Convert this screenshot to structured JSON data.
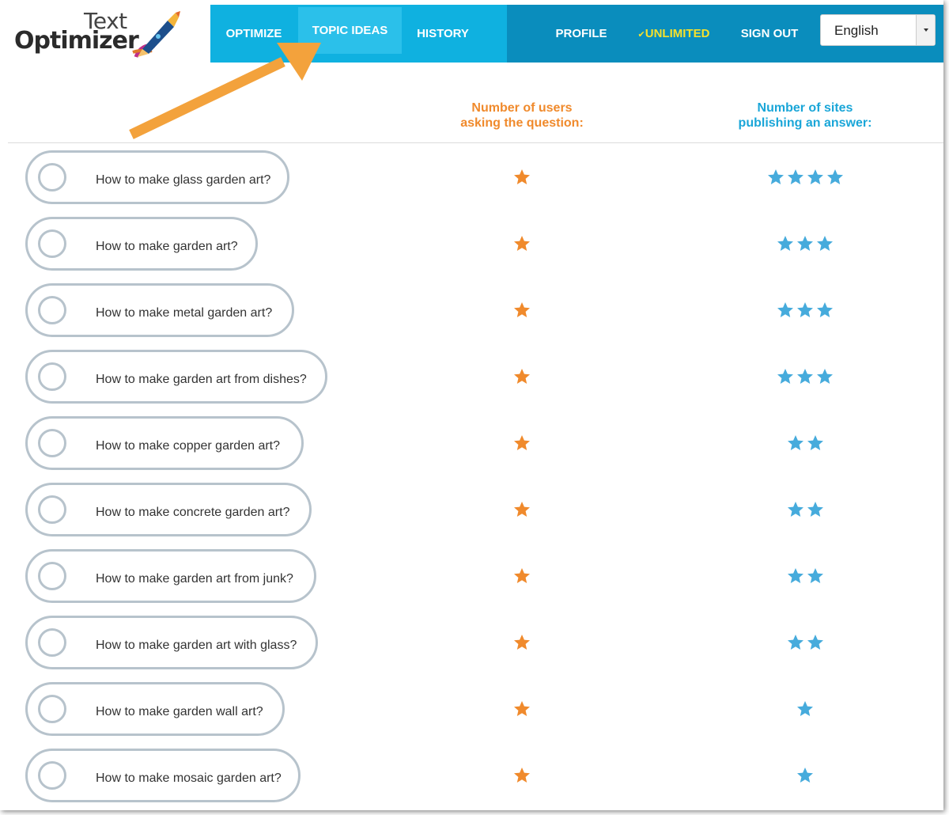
{
  "app": {
    "logo_line1": "Text",
    "logo_line2": "Optimizer"
  },
  "nav": {
    "items": [
      "OPTIMIZE",
      "TOPIC IDEAS",
      "HISTORY",
      "PROFILE",
      "UNLIMITED",
      "SIGN OUT"
    ],
    "active": "TOPIC IDEAS",
    "unlimited_check": "✔",
    "language": "English"
  },
  "colors": {
    "nav_light": "#0fb1e0",
    "nav_dark": "#0a8dbd",
    "orange": "#f08a2c",
    "blue": "#46abdc",
    "unlimited": "#f7e12b"
  },
  "columns": {
    "users_line1": "Number of users",
    "users_line2": "asking the question:",
    "sites_line1": "Number of sites",
    "sites_line2": "publishing an answer:"
  },
  "questions": [
    {
      "text": "How to make glass garden art?",
      "users_stars": 1,
      "sites_stars": 4
    },
    {
      "text": "How to make garden art?",
      "users_stars": 1,
      "sites_stars": 3
    },
    {
      "text": "How to make metal garden art?",
      "users_stars": 1,
      "sites_stars": 3
    },
    {
      "text": "How to make garden art from dishes?",
      "users_stars": 1,
      "sites_stars": 3
    },
    {
      "text": "How to make copper garden art?",
      "users_stars": 1,
      "sites_stars": 2
    },
    {
      "text": "How to make concrete garden art?",
      "users_stars": 1,
      "sites_stars": 2
    },
    {
      "text": "How to make garden art from junk?",
      "users_stars": 1,
      "sites_stars": 2
    },
    {
      "text": "How to make garden art with glass?",
      "users_stars": 1,
      "sites_stars": 2
    },
    {
      "text": "How to make garden wall art?",
      "users_stars": 1,
      "sites_stars": 1
    },
    {
      "text": "How to make mosaic garden art?",
      "users_stars": 1,
      "sites_stars": 1
    }
  ]
}
